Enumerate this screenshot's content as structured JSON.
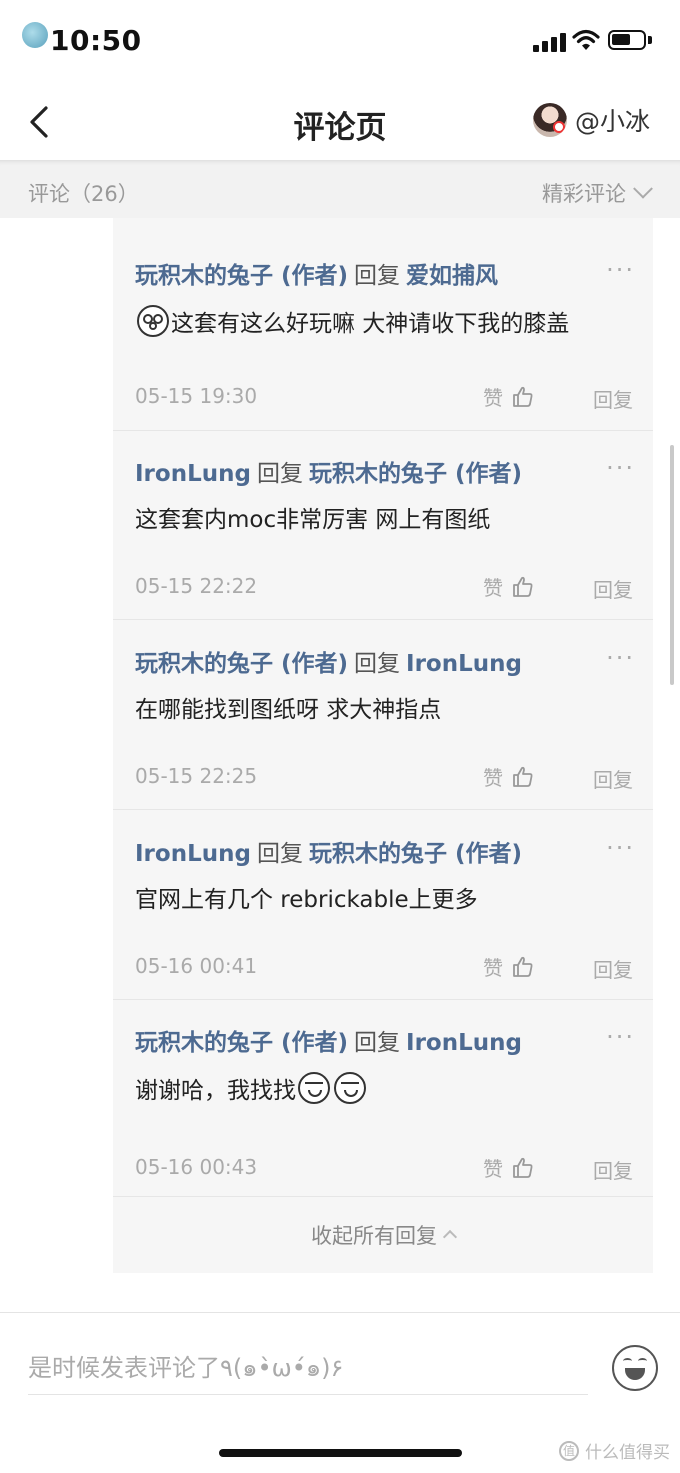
{
  "status_bar": {
    "time": "10:50",
    "logo_text": "什么值得买"
  },
  "header": {
    "title": "评论页",
    "user_name": "@小冰"
  },
  "comments_bar": {
    "count_label": "评论（26）",
    "sort_label": "精彩评论"
  },
  "replies": [
    {
      "author": "玩积木的兔子 (作者)",
      "verb": "回复",
      "target": "爱如捕风",
      "text": "这套有这么好玩嘛 大神请收下我的膝盖",
      "time": "05-15 19:30",
      "like_label": "赞",
      "reply_label": "回复",
      "more": "···",
      "emoji_before": "shocked-face-emoji"
    },
    {
      "author": "IronLung",
      "verb": "回复",
      "target": "玩积木的兔子 (作者)",
      "text": "这套套内moc非常厉害 网上有图纸",
      "time": "05-15 22:22",
      "like_label": "赞",
      "reply_label": "回复",
      "more": "···"
    },
    {
      "author": "玩积木的兔子 (作者)",
      "verb": "回复",
      "target": "IronLung",
      "text": "在哪能找到图纸呀 求大神指点",
      "time": "05-15 22:25",
      "like_label": "赞",
      "reply_label": "回复",
      "more": "···"
    },
    {
      "author": "IronLung",
      "verb": "回复",
      "target": "玩积木的兔子 (作者)",
      "text": "官网上有几个 rebrickable上更多",
      "time": "05-16 00:41",
      "like_label": "赞",
      "reply_label": "回复",
      "more": "···"
    },
    {
      "author": "玩积木的兔子 (作者)",
      "verb": "回复",
      "target": "IronLung",
      "text": "谢谢哈，我找找",
      "time": "05-16 00:43",
      "like_label": "赞",
      "reply_label": "回复",
      "more": "···",
      "emoji_after": "smirk-face-emoji"
    }
  ],
  "collapse_label": "收起所有回复",
  "composer": {
    "placeholder": "是时候发表评论了٩(๑•̀ω•́๑)۶"
  },
  "watermark": "什么值得买"
}
